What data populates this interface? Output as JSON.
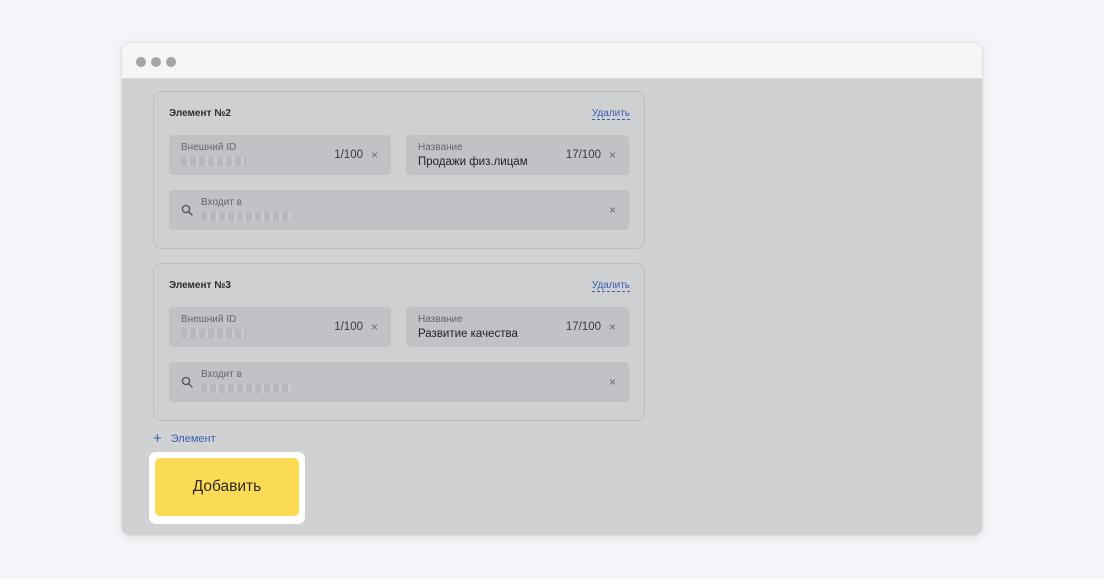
{
  "window": {
    "controls": [
      "window-dot",
      "window-dot",
      "window-dot"
    ]
  },
  "elements": [
    {
      "title": "Элемент №2",
      "delete_label": "Удалить",
      "external_id": {
        "label": "Внешний ID",
        "counter": "1/100"
      },
      "name": {
        "label": "Название",
        "value": "Продажи физ.лицам",
        "counter": "17/100"
      },
      "includes": {
        "label": "Входит в"
      }
    },
    {
      "title": "Элемент №3",
      "delete_label": "Удалить",
      "external_id": {
        "label": "Внешний ID",
        "counter": "1/100"
      },
      "name": {
        "label": "Название",
        "value": "Развитие качества",
        "counter": "17/100"
      },
      "includes": {
        "label": "Входит в"
      }
    }
  ],
  "add_element_label": "Элемент",
  "add_button_label": "Добавить",
  "icons": {
    "clear": "×",
    "plus": "+",
    "search": "search-icon"
  },
  "colors": {
    "accent": "#3a5fb0",
    "primary_button": "#fbdb53",
    "overlay": "#d0d1d2"
  }
}
